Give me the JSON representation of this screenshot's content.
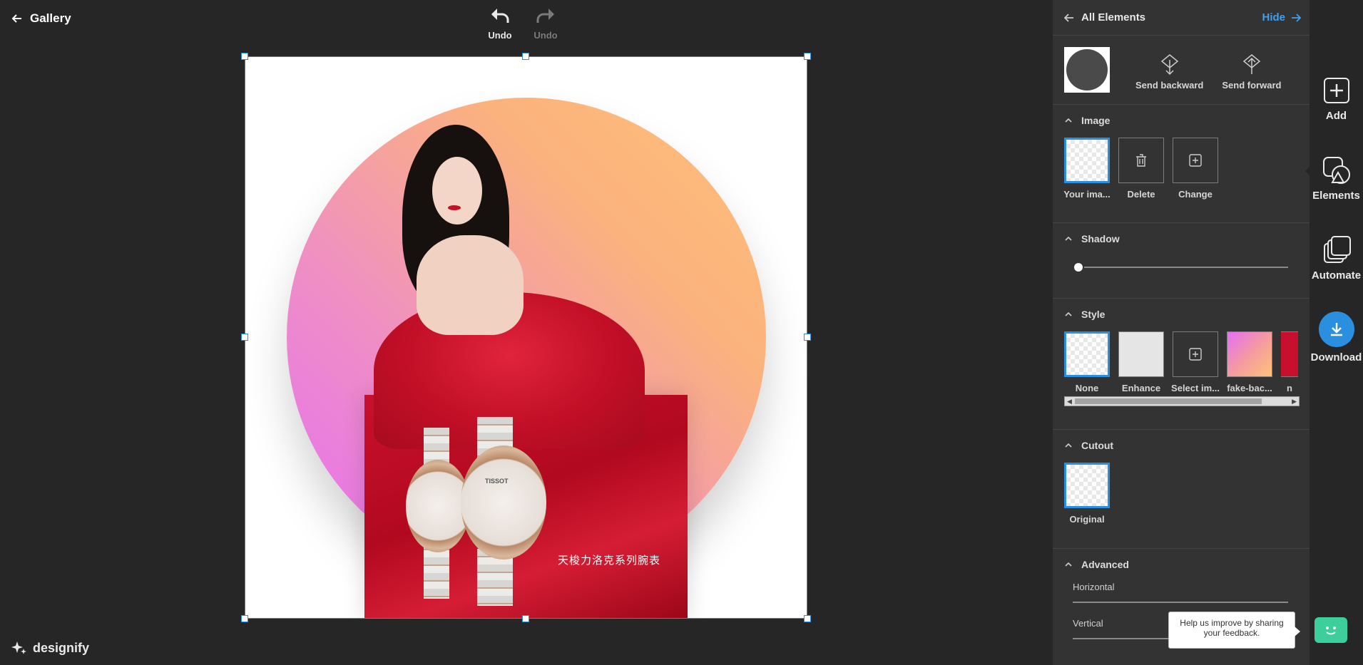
{
  "header": {
    "gallery_label": "Gallery",
    "undo_label": "Undo",
    "redo_label": "Undo"
  },
  "canvas": {
    "caption": "天梭力洛克系列腕表",
    "watch_brand": "TISSOT"
  },
  "logo": {
    "text": "designify"
  },
  "panel": {
    "back_label": "All Elements",
    "hide_label": "Hide",
    "send_backward": "Send backward",
    "send_forward": "Send forward",
    "image": {
      "title": "Image",
      "tiles": [
        {
          "label": "Your ima...",
          "icon": "transparent-thumb"
        },
        {
          "label": "Delete",
          "icon": "trash-icon"
        },
        {
          "label": "Change",
          "icon": "plus-square-icon"
        }
      ]
    },
    "shadow": {
      "title": "Shadow",
      "value": 0
    },
    "style": {
      "title": "Style",
      "tiles": [
        {
          "label": "None"
        },
        {
          "label": "Enhance"
        },
        {
          "label": "Select im..."
        },
        {
          "label": "fake-bac..."
        },
        {
          "label": "n"
        }
      ]
    },
    "cutout": {
      "title": "Cutout",
      "tiles": [
        {
          "label": "Original"
        }
      ]
    },
    "advanced": {
      "title": "Advanced",
      "horizontal_label": "Horizontal",
      "vertical_label": "Vertical",
      "vertical_value": 0.53
    }
  },
  "rail": {
    "add": "Add",
    "elements": "Elements",
    "automate": "Automate",
    "download": "Download"
  },
  "feedback": {
    "text": "Help us improve by sharing your feedback."
  },
  "colors": {
    "accent": "#2b8fe0",
    "panel_bg": "#333333",
    "app_bg": "#262626",
    "bot": "#3ccf9b"
  }
}
